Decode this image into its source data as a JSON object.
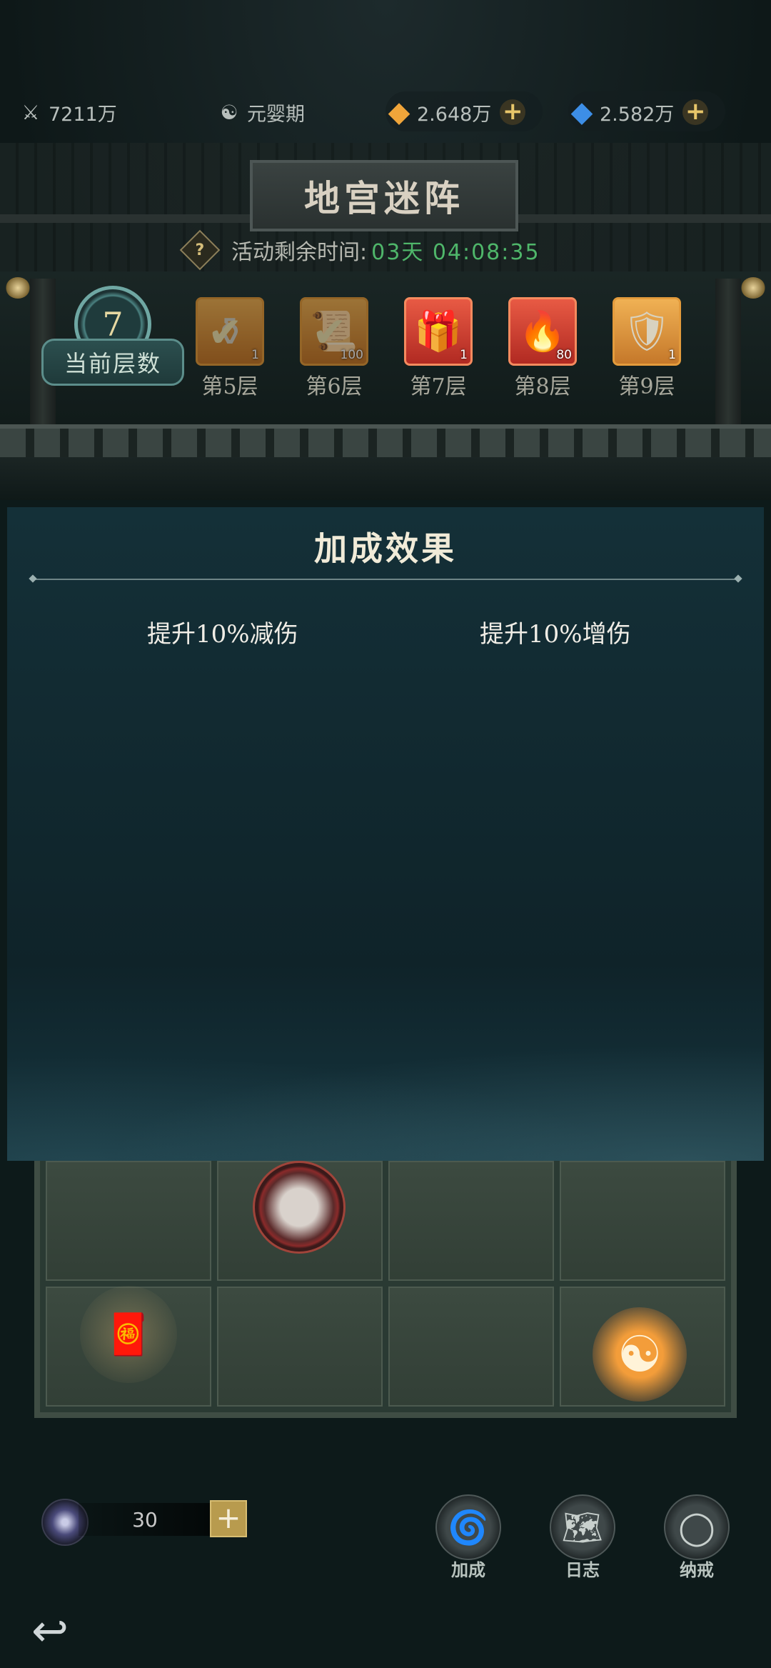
{
  "resources": {
    "power": {
      "icon": "crossed-swords-icon",
      "value": "7211万"
    },
    "realm": {
      "icon": "taiji-icon",
      "value": "元婴期"
    },
    "gold_gem": {
      "icon": "amber-crystal-icon",
      "value": "2.648万"
    },
    "blue_gem": {
      "icon": "blue-crystal-icon",
      "value": "2.582万"
    }
  },
  "title": "地宫迷阵",
  "timer": {
    "label": "活动剩余时间:",
    "value": "03天 04:08:35"
  },
  "current_layer": {
    "number": "7",
    "label": "当前层数"
  },
  "rewards": [
    {
      "label": "第5层",
      "count": "1",
      "claimed": true,
      "icon": "bronze-vessel-icon"
    },
    {
      "label": "第6层",
      "count": "100",
      "claimed": true,
      "icon": "gold-scroll-icon"
    },
    {
      "label": "第7层",
      "count": "1",
      "claimed": false,
      "icon": "gift-box-icon"
    },
    {
      "label": "第8层",
      "count": "80",
      "claimed": false,
      "icon": "red-charm-icon"
    },
    {
      "label": "第9层",
      "count": "1",
      "claimed": false,
      "icon": "armor-icon"
    }
  ],
  "panel": {
    "title": "加成效果",
    "effects": [
      "提升10%减伤",
      "提升10%增伤"
    ]
  },
  "energy": {
    "value": "30"
  },
  "tools": [
    {
      "label": "加成",
      "icon": "swirl-icon"
    },
    {
      "label": "日志",
      "icon": "scroll-map-icon"
    },
    {
      "label": "纳戒",
      "icon": "ring-icon"
    }
  ],
  "colors": {
    "accent": "#4fb66a",
    "panel": "#143038",
    "gold": "#d7bd72"
  }
}
